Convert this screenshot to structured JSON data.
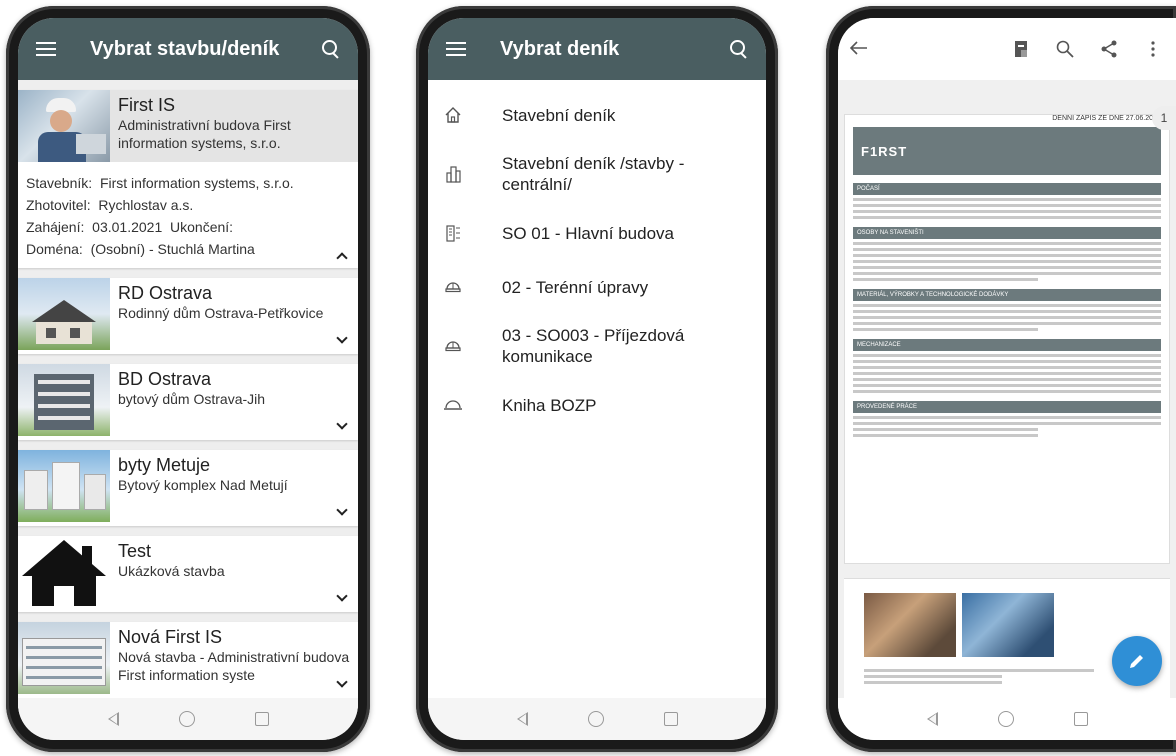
{
  "screen1": {
    "title": "Vybrat stavbu/deník",
    "expanded": {
      "title": "First IS",
      "subtitle": "Administrativní budova First information systems, s.r.o.",
      "stavebnik_label": "Stavebník:",
      "stavebnik": "First information systems, s.r.o.",
      "zhotovitel_label": "Zhotovitel:",
      "zhotovitel": "Rychlostav a.s.",
      "zahajeni_label": "Zahájení:",
      "zahajeni": "03.01.2021",
      "ukonceni_label": "Ukončení:",
      "domena_label": "Doména:",
      "domena": "(Osobní) - Stuchlá Martina"
    },
    "items": [
      {
        "title": "RD Ostrava",
        "subtitle": "Rodinný dům Ostrava-Petřkovice"
      },
      {
        "title": "BD Ostrava",
        "subtitle": "bytový dům Ostrava-Jih"
      },
      {
        "title": "byty Metuje",
        "subtitle": "Bytový komplex Nad Metují"
      },
      {
        "title": "Test",
        "subtitle": "Ukázková stavba"
      },
      {
        "title": "Nová First IS",
        "subtitle": "Nová stavba - Administrativní budova First information syste"
      }
    ]
  },
  "screen2": {
    "title": "Vybrat deník",
    "items": [
      {
        "label": "Stavební deník",
        "icon": "home-icon"
      },
      {
        "label": "Stavební deník /stavby - centrální/",
        "icon": "buildings-icon"
      },
      {
        "label": "SO 01 - Hlavní budova",
        "icon": "building-floors-icon"
      },
      {
        "label": "02 - Terénní úpravy",
        "icon": "helmet-icon"
      },
      {
        "label": "03 - SO003 - Příjezdová komunikace",
        "icon": "helmet-icon"
      },
      {
        "label": "Kniha BOZP",
        "icon": "hardhat-icon"
      }
    ]
  },
  "screen3": {
    "page_number": "1",
    "pdf_logo": "F1RST",
    "pdf_date": "DENNÍ ZÁPIS ZE DNE 27.06.20",
    "sections": [
      "POČASÍ",
      "OSOBY NA STAVENIŠTI",
      "MATERIÁL, VÝROBKY A TECHNOLOGICKÉ DODÁVKY",
      "MECHANIZACE",
      "PROVEDENÉ PRÁCE"
    ]
  },
  "colors": {
    "appbar": "#4a5e61",
    "fab": "#2f8fd6"
  }
}
